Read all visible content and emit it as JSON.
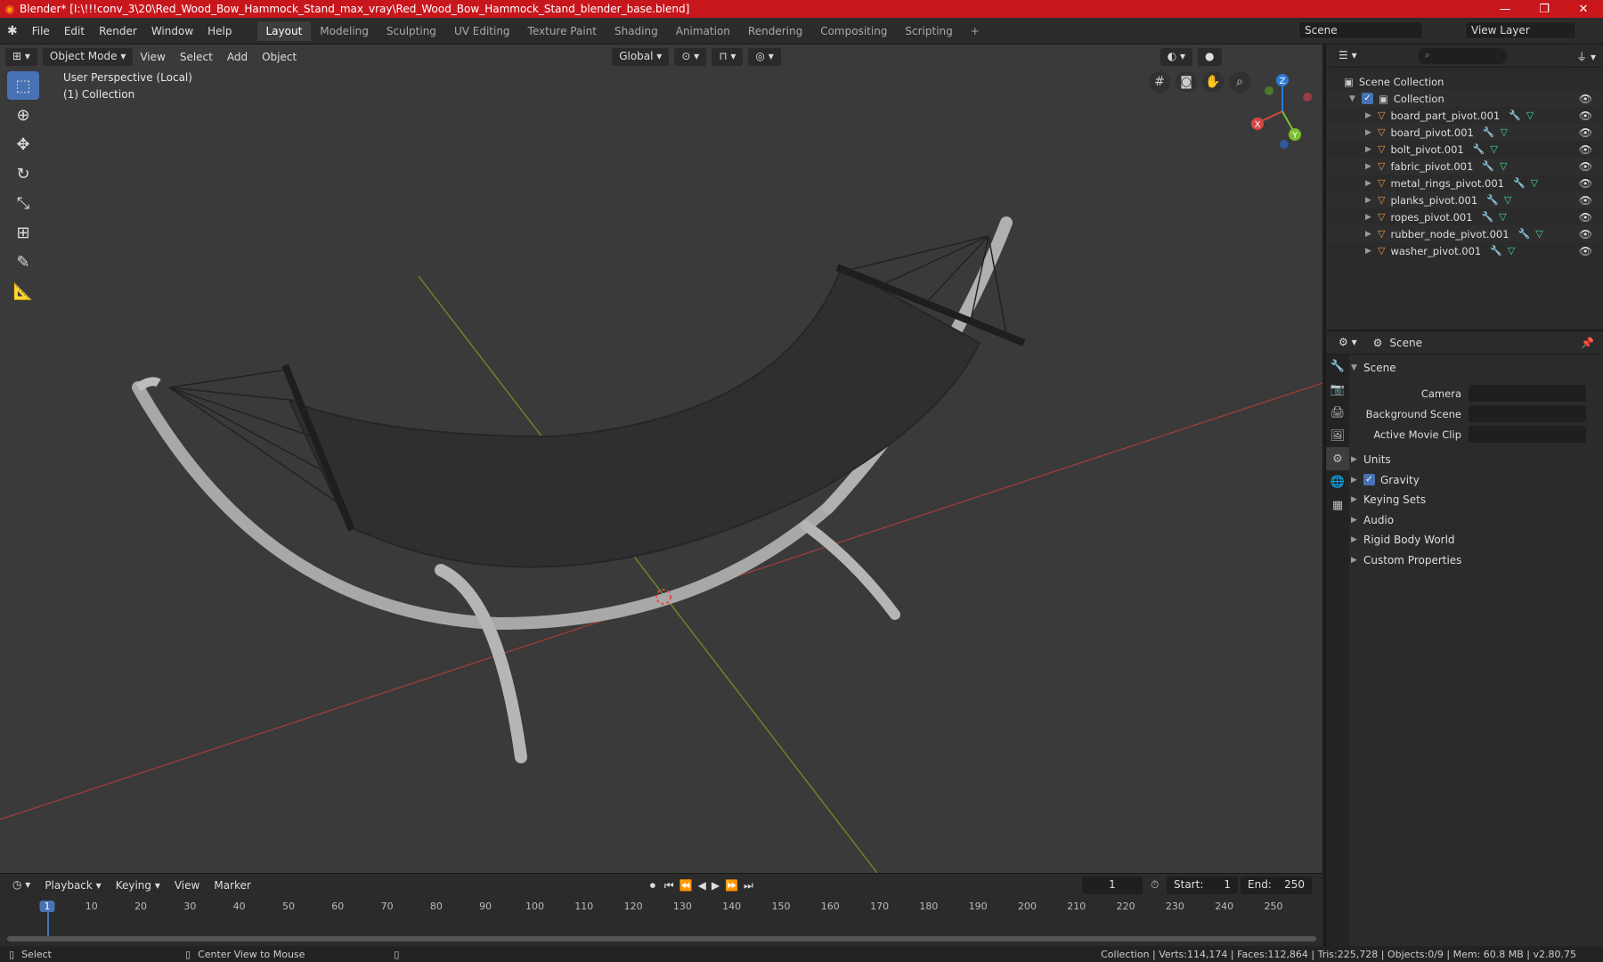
{
  "window": {
    "title": "Blender* [I:\\!!!conv_3\\20\\Red_Wood_Bow_Hammock_Stand_max_vray\\Red_Wood_Bow_Hammock_Stand_blender_base.blend]"
  },
  "menu": [
    "File",
    "Edit",
    "Render",
    "Window",
    "Help"
  ],
  "workspaces": [
    "Layout",
    "Modeling",
    "Sculpting",
    "UV Editing",
    "Texture Paint",
    "Shading",
    "Animation",
    "Rendering",
    "Compositing",
    "Scripting"
  ],
  "active_workspace": "Layout",
  "scene_name": "Scene",
  "view_layer": "View Layer",
  "viewport": {
    "mode": "Object Mode",
    "menus": [
      "View",
      "Select",
      "Add",
      "Object"
    ],
    "transform_orientation": "Global",
    "info_line1": "User Perspective (Local)",
    "info_line2": "(1) Collection",
    "gizmo_axes": [
      "X",
      "Y",
      "Z"
    ]
  },
  "outliner": {
    "root": "Scene Collection",
    "collection": "Collection",
    "objects": [
      "board_part_pivot.001",
      "board_pivot.001",
      "bolt_pivot.001",
      "fabric_pivot.001",
      "metal_rings_pivot.001",
      "planks_pivot.001",
      "ropes_pivot.001",
      "rubber_node_pivot.001",
      "washer_pivot.001"
    ]
  },
  "properties": {
    "header": "Scene",
    "panel_title": "Scene",
    "fields": [
      {
        "label": "Camera",
        "value": ""
      },
      {
        "label": "Background Scene",
        "value": ""
      },
      {
        "label": "Active Movie Clip",
        "value": ""
      }
    ],
    "subpanels": [
      "Units",
      "Gravity",
      "Keying Sets",
      "Audio",
      "Rigid Body World",
      "Custom Properties"
    ],
    "gravity_checked": true
  },
  "timeline": {
    "menus": [
      "Playback",
      "Keying",
      "View",
      "Marker"
    ],
    "current_frame": "1",
    "start_label": "Start:",
    "start": "1",
    "end_label": "End:",
    "end": "250",
    "ticks": [
      "1",
      "10",
      "20",
      "30",
      "40",
      "50",
      "60",
      "70",
      "80",
      "90",
      "100",
      "110",
      "120",
      "130",
      "140",
      "150",
      "160",
      "170",
      "180",
      "190",
      "200",
      "210",
      "220",
      "230",
      "240",
      "250"
    ]
  },
  "statusbar": {
    "left": "Select",
    "middle": "Center View to Mouse",
    "right": "Collection | Verts:114,174 | Faces:112,864 | Tris:225,728 | Objects:0/9 | Mem: 60.8 MB | v2.80.75"
  }
}
